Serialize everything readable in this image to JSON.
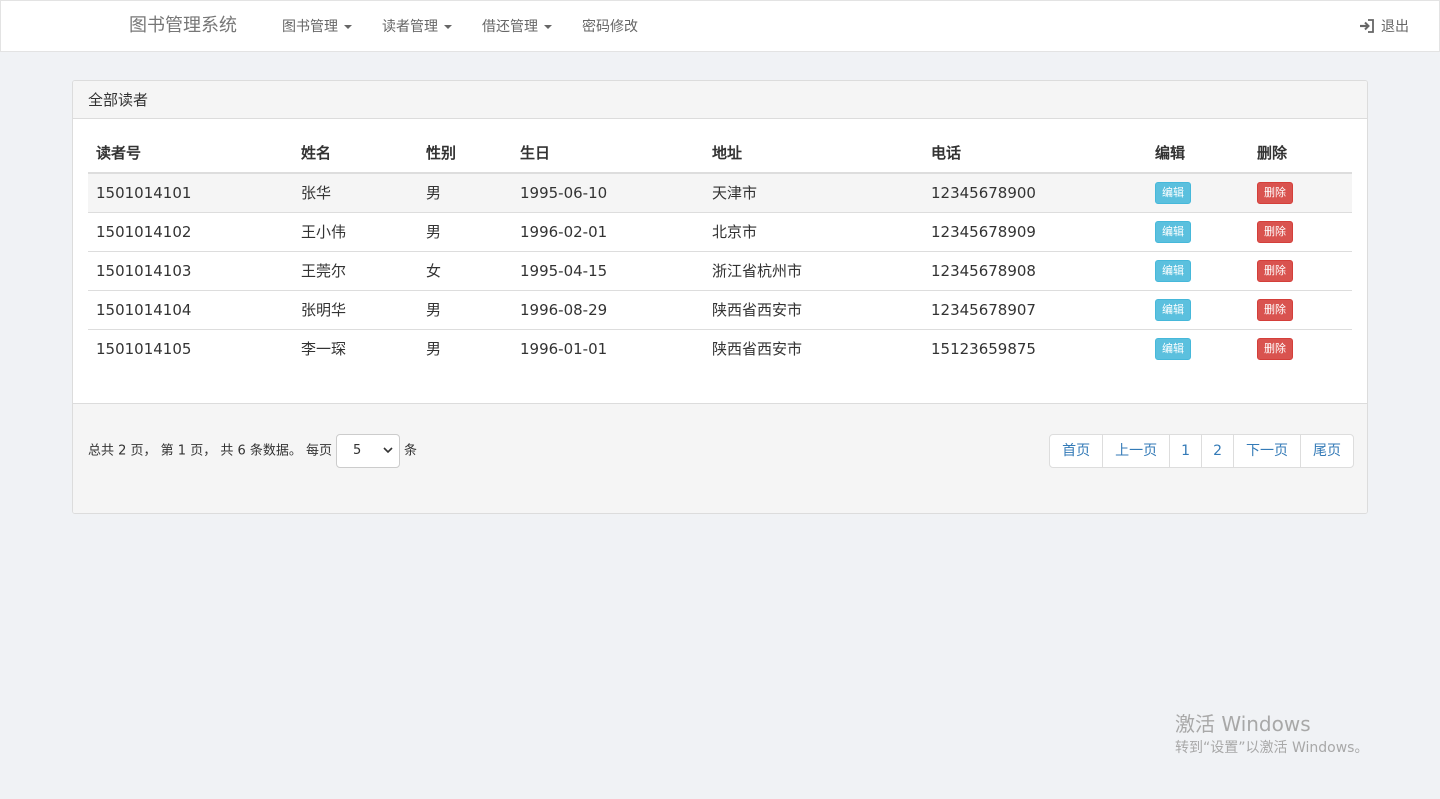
{
  "navbar": {
    "brand": "图书管理系统",
    "items": [
      {
        "label": "图书管理",
        "dropdown": true
      },
      {
        "label": "读者管理",
        "dropdown": true
      },
      {
        "label": "借还管理",
        "dropdown": true
      },
      {
        "label": "密码修改",
        "dropdown": false
      }
    ],
    "logout_label": "退出",
    "logout_icon": "sign-out-icon"
  },
  "panel": {
    "title": "全部读者",
    "columns": [
      "读者号",
      "姓名",
      "性别",
      "生日",
      "地址",
      "电话",
      "编辑",
      "删除"
    ],
    "rows": [
      {
        "id": "1501014101",
        "name": "张华",
        "gender": "男",
        "birthday": "1995-06-10",
        "address": "天津市",
        "phone": "12345678900",
        "edit": "编辑",
        "delete": "删除"
      },
      {
        "id": "1501014102",
        "name": "王小伟",
        "gender": "男",
        "birthday": "1996-02-01",
        "address": "北京市",
        "phone": "12345678909",
        "edit": "编辑",
        "delete": "删除"
      },
      {
        "id": "1501014103",
        "name": "王莞尔",
        "gender": "女",
        "birthday": "1995-04-15",
        "address": "浙江省杭州市",
        "phone": "12345678908",
        "edit": "编辑",
        "delete": "删除"
      },
      {
        "id": "1501014104",
        "name": "张明华",
        "gender": "男",
        "birthday": "1996-08-29",
        "address": "陕西省西安市",
        "phone": "12345678907",
        "edit": "编辑",
        "delete": "删除"
      },
      {
        "id": "1501014105",
        "name": "李一琛",
        "gender": "男",
        "birthday": "1996-01-01",
        "address": "陕西省西安市",
        "phone": "15123659875",
        "edit": "编辑",
        "delete": "删除"
      }
    ]
  },
  "footer": {
    "summary": "总共 2 页， 第 1 页， 共 6 条数据。 每页",
    "page_size": "5",
    "unit": "条",
    "pagination": [
      "首页",
      "上一页",
      "1",
      "2",
      "下一页",
      "尾页"
    ]
  },
  "watermark": {
    "line1": "激活 Windows",
    "line2": "转到“设置”以激活 Windows。"
  },
  "colors": {
    "link": "#337ab7",
    "info": "#5bc0de",
    "danger": "#d9534f",
    "background": "#f0f2f5"
  }
}
